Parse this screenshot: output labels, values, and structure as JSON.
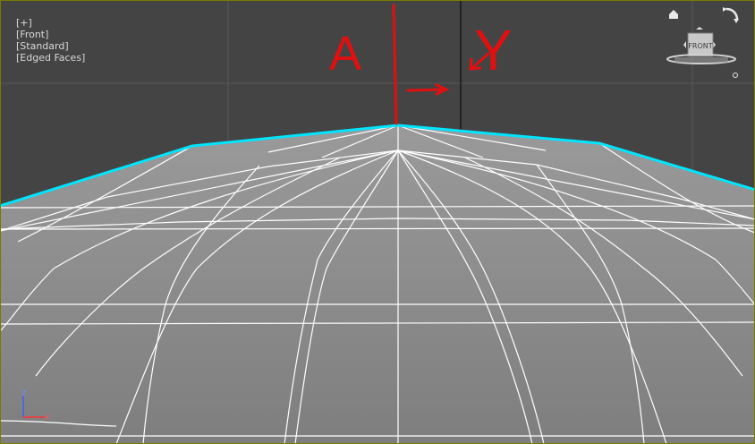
{
  "viewport": {
    "menu_plus": "[+]",
    "menu_view": "[Front]",
    "menu_shading": "[Standard]",
    "menu_display": "[Edged Faces]"
  },
  "viewcube": {
    "face_label": "FRONT",
    "home_icon": "home-icon",
    "rotate_icon": "rotate-arrow-icon",
    "options_icon": "options-icon"
  },
  "annotations": {
    "letter_left": "A",
    "letter_right": "Y",
    "color": "#e01010"
  },
  "axis_gizmo": {
    "z_label": "Z",
    "x_label": "X",
    "z_color": "#4060ff",
    "x_color": "#ff3030"
  },
  "colors": {
    "background_top": "#444444",
    "surface": "#8a8a8a",
    "wire": "#ffffff",
    "selection_edge": "#00e5ff",
    "grid": "#5a5a5a"
  }
}
